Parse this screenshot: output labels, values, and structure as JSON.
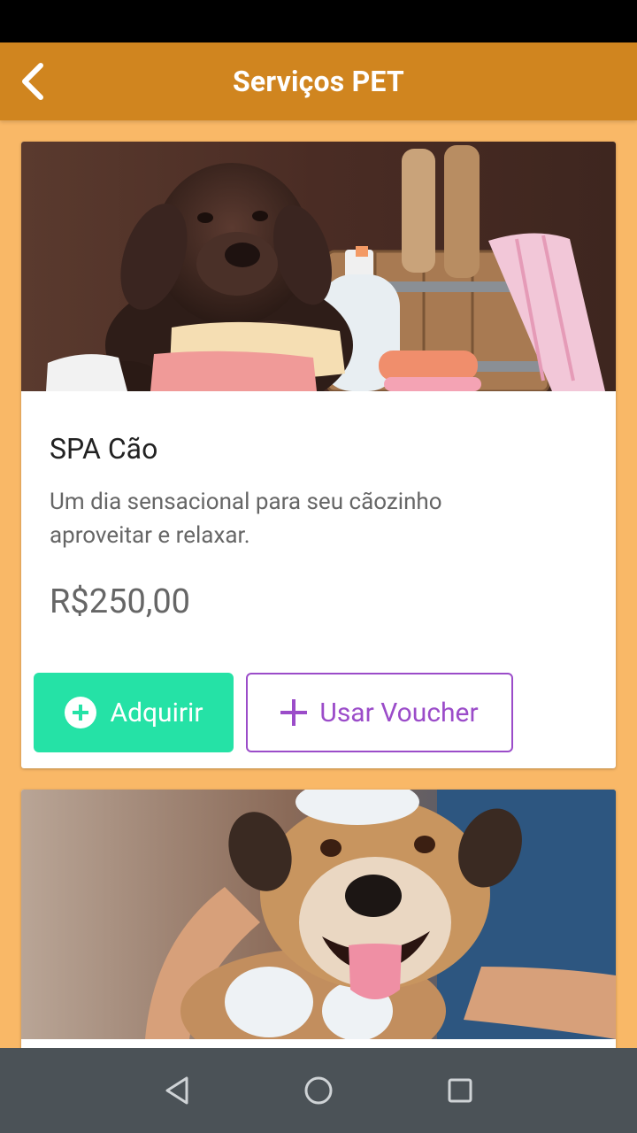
{
  "app_bar": {
    "title": "Serviços PET",
    "back_icon": "chevron-left-icon",
    "color": "#D0851F"
  },
  "background_color": "#F9B867",
  "services": [
    {
      "image": "chocolate-labrador-puppy-with-towels-and-bath-products",
      "title": "SPA Cão",
      "description": "Um dia sensacional para seu cãozinho aproveitar e relaxar.",
      "price": "R$250,00",
      "buy_label": "Adquirir",
      "buy_icon": "plus-circle-icon",
      "voucher_label": "Usar Voucher",
      "voucher_icon": "plus-icon"
    },
    {
      "image": "smiling-dog-being-bathed-with-foam"
    }
  ],
  "colors": {
    "buy_button": "#25E2A6",
    "voucher_accent": "#9B4CC9"
  },
  "nav_bar": {
    "back_icon": "triangle-back-icon",
    "home_icon": "circle-home-icon",
    "recents_icon": "square-recents-icon"
  }
}
